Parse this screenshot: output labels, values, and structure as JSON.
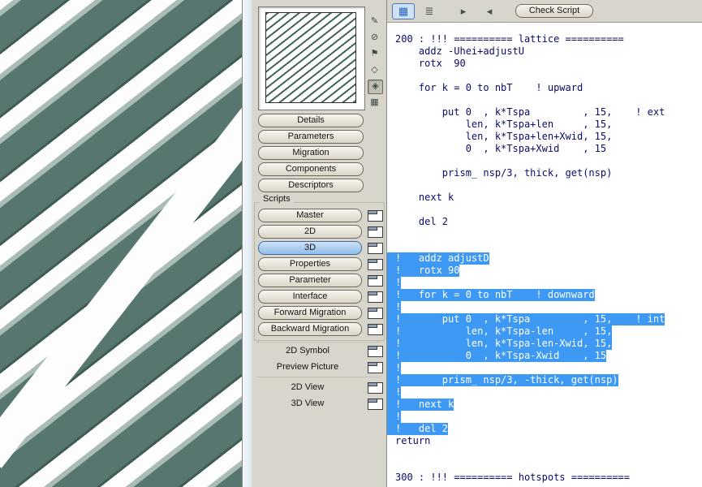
{
  "colors": {
    "selection": "#3e99f5",
    "code_text": "#0b0b6b",
    "active_script_button": "#8fbce9",
    "slat_face": "#587670"
  },
  "panel": {
    "section_buttons": [
      {
        "label": "Details"
      },
      {
        "label": "Parameters"
      },
      {
        "label": "Migration"
      },
      {
        "label": "Components"
      },
      {
        "label": "Descriptors"
      }
    ],
    "scripts_label": "Scripts",
    "script_buttons": [
      {
        "label": "Master",
        "active": false
      },
      {
        "label": "2D",
        "active": false
      },
      {
        "label": "3D",
        "active": true
      },
      {
        "label": "Properties",
        "active": false
      },
      {
        "label": "Parameter",
        "active": false
      },
      {
        "label": "Interface",
        "active": false
      },
      {
        "label": "Forward Migration",
        "active": false
      },
      {
        "label": "Backward Migration",
        "active": false
      }
    ],
    "symbol_rows": [
      {
        "label": "2D Symbol"
      },
      {
        "label": "Preview Picture"
      }
    ],
    "view_rows": [
      {
        "label": "2D View"
      },
      {
        "label": "3D View"
      }
    ],
    "side_tools": [
      {
        "name": "pencil-icon",
        "glyph": "✎",
        "pressed": false
      },
      {
        "name": "no-symbol-icon",
        "glyph": "⊘",
        "pressed": false
      },
      {
        "name": "flag-icon",
        "glyph": "⚑",
        "pressed": false
      },
      {
        "name": "diamond-icon",
        "glyph": "◇",
        "pressed": false
      },
      {
        "name": "target-icon",
        "glyph": "◈",
        "pressed": true
      },
      {
        "name": "film-icon",
        "glyph": "▦",
        "pressed": false
      }
    ]
  },
  "toolbar": {
    "icons": [
      {
        "name": "dotted-grid-icon",
        "glyph": "▦",
        "pressed": true
      },
      {
        "name": "list-lines-icon",
        "glyph": "≣",
        "pressed": false
      },
      {
        "name": "window-forward-icon",
        "glyph": "▸",
        "pressed": false
      },
      {
        "name": "window-back-icon",
        "glyph": "◂",
        "pressed": false
      }
    ],
    "check_script_label": "Check Script"
  },
  "editor": {
    "lines": [
      {
        "text": "200 : !!! ========== lattice ==========",
        "hl": false
      },
      {
        "text": "    addz -Uhei+adjustU",
        "hl": false
      },
      {
        "text": "    rotx  90",
        "hl": false
      },
      {
        "text": "",
        "hl": false
      },
      {
        "text": "    for k = 0 to nbT    ! upward",
        "hl": false
      },
      {
        "text": "",
        "hl": false
      },
      {
        "text": "        put 0  , k*Tspa         , 15,    ! ext",
        "hl": false
      },
      {
        "text": "            len, k*Tspa+len     , 15,",
        "hl": false
      },
      {
        "text": "            len, k*Tspa+len+Xwid, 15,",
        "hl": false
      },
      {
        "text": "            0  , k*Tspa+Xwid    , 15",
        "hl": false
      },
      {
        "text": "",
        "hl": false
      },
      {
        "text": "        prism_ nsp/3, thick, get(nsp)",
        "hl": false
      },
      {
        "text": "",
        "hl": false
      },
      {
        "text": "    next k",
        "hl": false
      },
      {
        "text": "",
        "hl": false
      },
      {
        "text": "    del 2",
        "hl": false
      },
      {
        "text": "",
        "hl": false
      },
      {
        "text": "",
        "hl": false
      },
      {
        "text": "!   addz adjustD",
        "hl": true
      },
      {
        "text": "!   rotx 90",
        "hl": true
      },
      {
        "text": "!",
        "hl": true
      },
      {
        "text": "!   for k = 0 to nbT    ! downward",
        "hl": true
      },
      {
        "text": "!",
        "hl": true
      },
      {
        "text": "!       put 0  , k*Tspa         , 15,    ! int",
        "hl": true
      },
      {
        "text": "!           len, k*Tspa-len     , 15,",
        "hl": true
      },
      {
        "text": "!           len, k*Tspa-len-Xwid, 15,",
        "hl": true
      },
      {
        "text": "!           0  , k*Tspa-Xwid    , 15",
        "hl": true
      },
      {
        "text": "!",
        "hl": true
      },
      {
        "text": "!       prism_ nsp/3, -thick, get(nsp)",
        "hl": true
      },
      {
        "text": "!",
        "hl": true
      },
      {
        "text": "!   next k",
        "hl": true
      },
      {
        "text": "!",
        "hl": true
      },
      {
        "text": "!   del 2",
        "hl": true
      },
      {
        "text": "return",
        "hl": false
      },
      {
        "text": "",
        "hl": false
      },
      {
        "text": "",
        "hl": false
      },
      {
        "text": "300 : !!! ========== hotspots ==========",
        "hl": false
      }
    ]
  }
}
